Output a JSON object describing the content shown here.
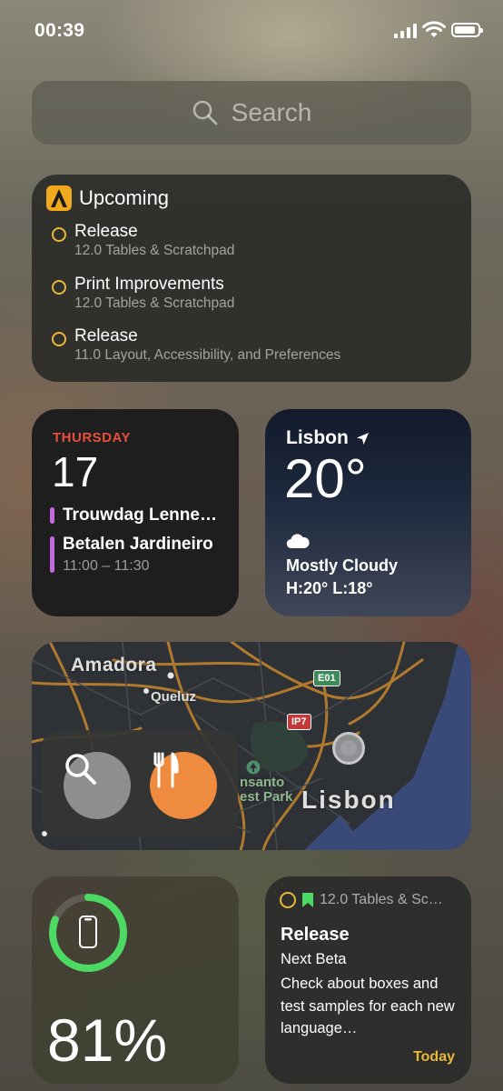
{
  "status_bar": {
    "time": "00:39"
  },
  "search": {
    "placeholder": "Search"
  },
  "upcoming": {
    "title": "Upcoming",
    "items": [
      {
        "title": "Release",
        "subtitle": "12.0 Tables & Scratchpad"
      },
      {
        "title": "Print Improvements",
        "subtitle": "12.0 Tables & Scratchpad"
      },
      {
        "title": "Release",
        "subtitle": "11.0 Layout, Accessibility, and Preferences"
      }
    ]
  },
  "calendar": {
    "weekday": "THURSDAY",
    "date": "17",
    "events": [
      {
        "title": "Trouwdag Lenne…"
      },
      {
        "title": "Betalen Jardineiro",
        "time": "11:00 – 11:30"
      }
    ]
  },
  "weather": {
    "city": "Lisbon",
    "temperature": "20°",
    "condition": "Mostly Cloudy",
    "high_low": "H:20° L:18°"
  },
  "map": {
    "labels": {
      "amadora": "Amadora",
      "queluz": "Queluz",
      "monsanto": "nsanto",
      "forest_park": "est Park",
      "lisbon": "Lisbon"
    },
    "shields": {
      "e01": "E01",
      "ip7": "IP7"
    },
    "actions": [
      {
        "icon": "search-icon",
        "color": "#8e8e8e"
      },
      {
        "icon": "fork-knife-icon",
        "color": "#ef8b3e"
      }
    ]
  },
  "battery": {
    "percent": "81%",
    "level": 0.81,
    "ring_color": "#4cd964"
  },
  "reminder": {
    "list": "12.0 Tables & Sc…",
    "title": "Release",
    "subtitle": "Next Beta",
    "note": "Check about boxes and test samples for each new language…",
    "due": "Today",
    "accent": "#e9b739"
  }
}
